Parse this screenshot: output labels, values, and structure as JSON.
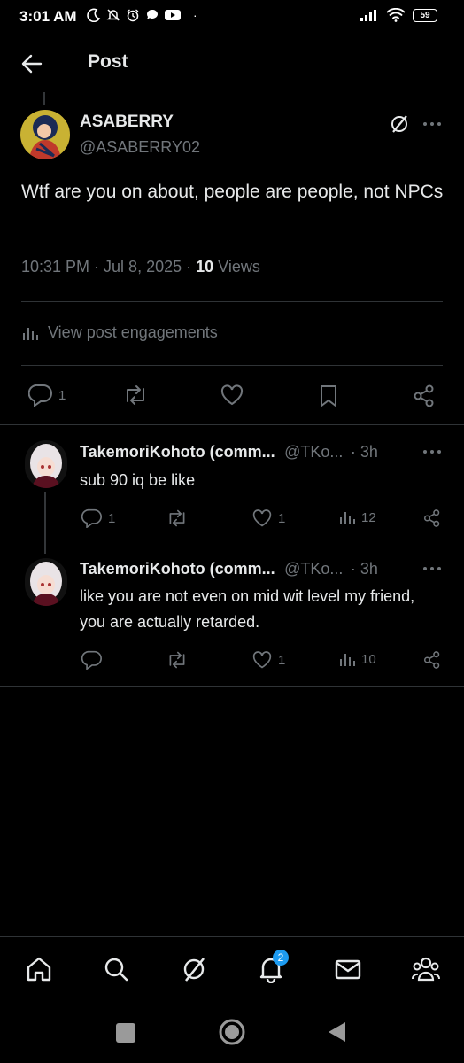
{
  "status_bar": {
    "time": "3:01 AM",
    "battery": "59"
  },
  "header": {
    "title": "Post"
  },
  "post": {
    "author_name": "ASABERRY",
    "author_handle": "@ASABERRY02",
    "text": "Wtf are you on about, people are people, not NPCs",
    "time": "10:31 PM · Jul 8, 2025 · ",
    "views_count": "10",
    "views_label": " Views",
    "engagements_label": "View post engagements",
    "reply_count": "1"
  },
  "replies": [
    {
      "name": "TakemoriKohoto (comm...",
      "handle": "@TKo...",
      "time": "· 3h",
      "text": "sub 90 iq be like",
      "reply_count": "1",
      "like_count": "1",
      "views": "12"
    },
    {
      "name": "TakemoriKohoto (comm...",
      "handle": "@TKo...",
      "time": "· 3h",
      "text": "like you are not even on mid wit level my friend, you are actually retarded.",
      "reply_count": "",
      "like_count": "1",
      "views": "10"
    }
  ],
  "bottom_nav": {
    "notifications_badge": "2"
  },
  "colors": {
    "background": "#000000",
    "text": "#e7e9ea",
    "muted": "#71767b",
    "divider": "#2f3336",
    "accent": "#1d9bf0"
  },
  "icons": [
    "back-arrow-icon",
    "grok-icon",
    "more-icon",
    "reply-icon",
    "repost-icon",
    "like-icon",
    "bookmark-icon",
    "share-icon",
    "views-icon",
    "home-icon",
    "search-icon",
    "bell-icon",
    "mail-icon",
    "communities-icon"
  ]
}
